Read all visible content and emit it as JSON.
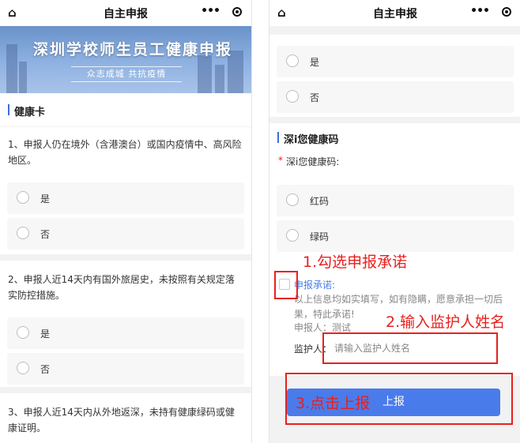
{
  "left": {
    "topbar": {
      "home_icon": "⌂",
      "title": "自主申报",
      "more_icon": "•••"
    },
    "banner": {
      "title": "深圳学校师生员工健康申报",
      "slogan": "众志成城 共抗疫情"
    },
    "section_title": "健康卡",
    "questions": [
      {
        "text": "1、申报人仍在境外（含港澳台）或国内疫情中、高风险地区。",
        "options": [
          "是",
          "否"
        ]
      },
      {
        "text": "2、申报人近14天内有国外旅居史，未按照有关规定落实防控措施。",
        "options": [
          "是",
          "否"
        ]
      },
      {
        "text": "3、申报人近14天内从外地返深，未持有健康绿码或健康证明。"
      }
    ]
  },
  "right": {
    "topbar": {
      "home_icon": "⌂",
      "title": "自主申报",
      "more_icon": "•••"
    },
    "prev_options": [
      "是",
      "否"
    ],
    "section_title": "深i您健康码",
    "field_label_required": "*",
    "field_label": "深i您健康码:",
    "code_options": [
      "红码",
      "绿码"
    ],
    "promise": {
      "title": "申报承诺:",
      "body": "以上信息均如实填写，如有隐瞒，愿意承担一切后果，特此承诺!",
      "applicant": "申报人：测试"
    },
    "guardian": {
      "label": "监护人：",
      "placeholder": "请输入监护人姓名",
      "value": ""
    },
    "submit_label": "上报",
    "annotations": {
      "step1": "1.勾选申报承诺",
      "step2": "2.输入监护人姓名",
      "step3": "3.点击上报"
    },
    "colors": {
      "accent": "#4a7bea",
      "annotation": "#e8201e"
    }
  }
}
